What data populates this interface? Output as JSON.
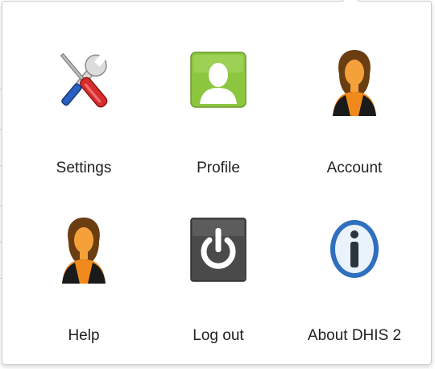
{
  "menu": {
    "apps": [
      {
        "label": "Settings",
        "icon": "settings-icon"
      },
      {
        "label": "Profile",
        "icon": "profile-icon"
      },
      {
        "label": "Account",
        "icon": "account-icon"
      },
      {
        "label": "Help",
        "icon": "help-icon"
      },
      {
        "label": "Log out",
        "icon": "logout-icon"
      },
      {
        "label": "About DHIS 2",
        "icon": "info-icon"
      }
    ]
  },
  "colors": {
    "profile_green": "#8cc63f",
    "logout_dark": "#4a4a4a",
    "info_blue": "#2f6fbf",
    "person_orange": "#f08a1c",
    "hair_brown": "#6b3e12"
  }
}
